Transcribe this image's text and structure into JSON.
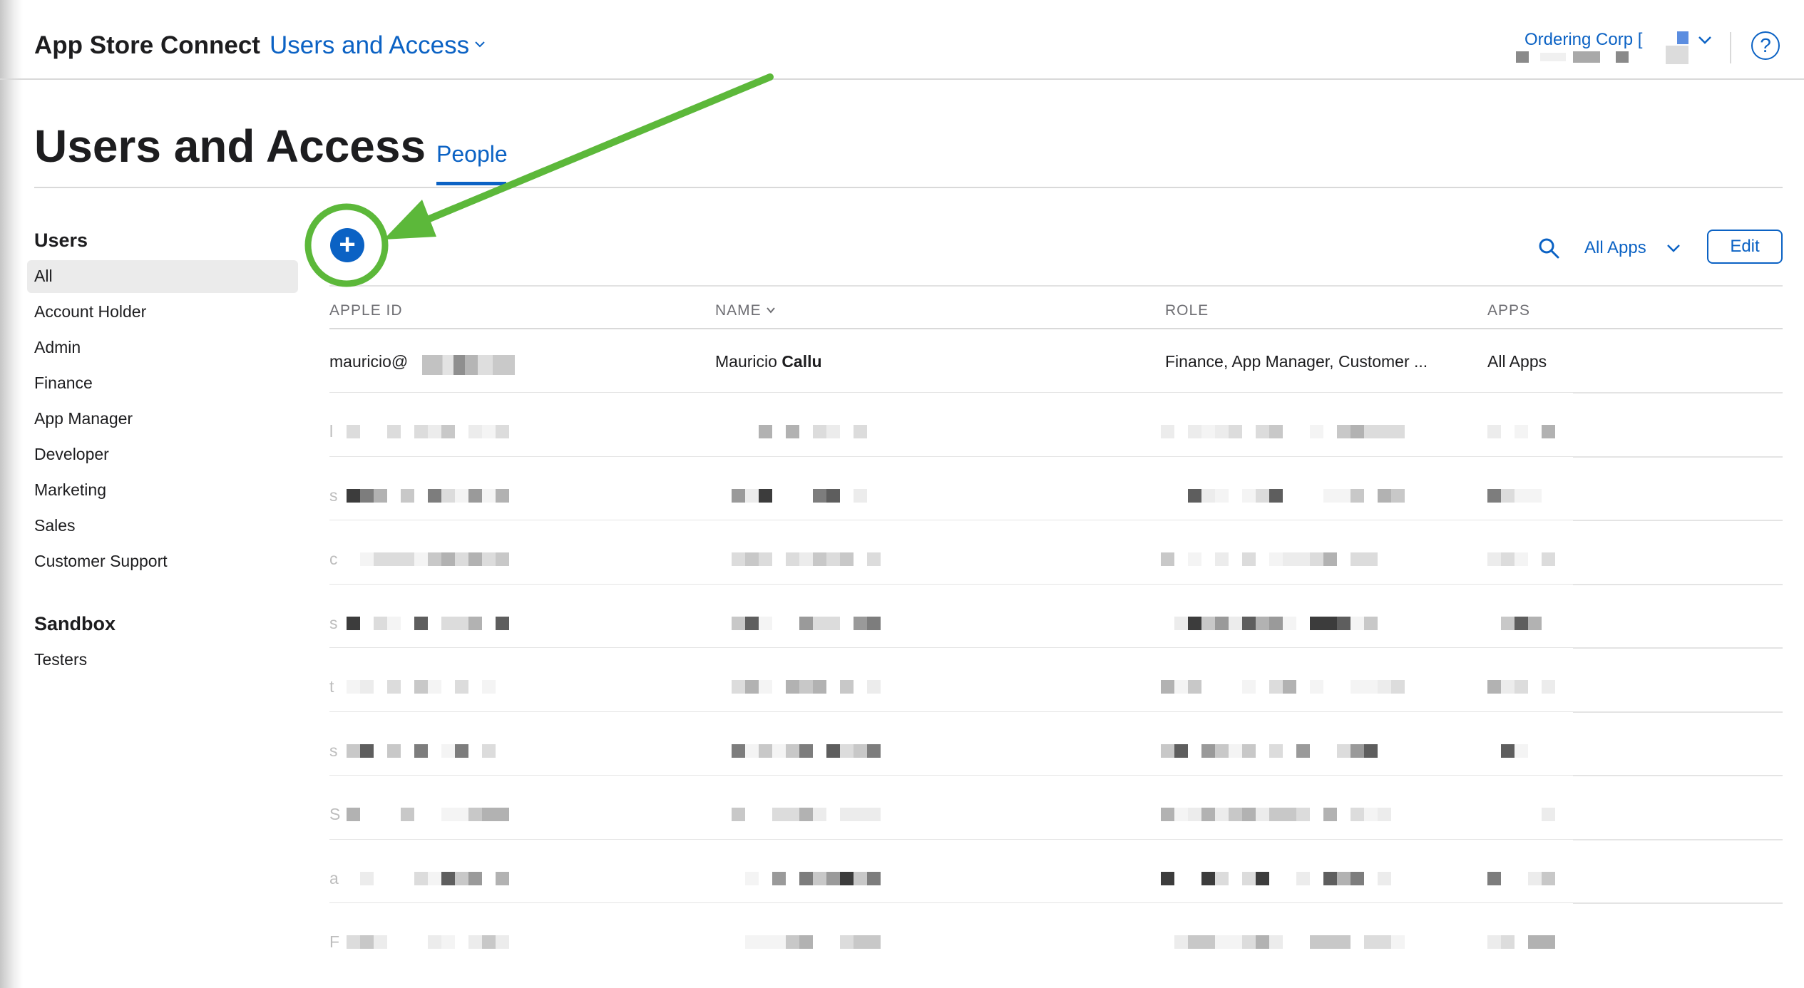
{
  "header": {
    "brand": "App Store Connect",
    "section_link": "Users and Access",
    "account_name": "Ordering Corp [",
    "help_label": "?"
  },
  "page": {
    "title": "Users and Access",
    "tabs": [
      {
        "label": "People",
        "active": true
      }
    ]
  },
  "sidebar": {
    "users_heading": "Users",
    "user_items": [
      {
        "label": "All",
        "selected": true
      },
      {
        "label": "Account Holder"
      },
      {
        "label": "Admin"
      },
      {
        "label": "Finance"
      },
      {
        "label": "App Manager"
      },
      {
        "label": "Developer"
      },
      {
        "label": "Marketing"
      },
      {
        "label": "Sales"
      },
      {
        "label": "Customer Support"
      }
    ],
    "sandbox_heading": "Sandbox",
    "sandbox_items": [
      {
        "label": "Testers"
      }
    ]
  },
  "toolbar": {
    "add_label": "+",
    "filter_label": "All Apps",
    "edit_label": "Edit"
  },
  "table": {
    "columns": [
      "APPLE ID",
      "NAME",
      "ROLE",
      "APPS"
    ],
    "sorted_column": "NAME",
    "rows": [
      {
        "apple_id": "mauricio@",
        "name_first": "Mauricio",
        "name_last": "Callu",
        "role": "Finance, App Manager, Customer ...",
        "apps": "All Apps"
      }
    ],
    "redacted_row_initials": [
      "l",
      "s",
      "c",
      "s",
      "t",
      "s",
      "S",
      "a",
      "F"
    ]
  },
  "colors": {
    "accent": "#0b62c4",
    "annotation": "#5cb83a"
  },
  "icons": [
    "chevron-down-icon",
    "help-icon",
    "plus-icon",
    "search-icon",
    "arrow-annotation",
    "circle-annotation"
  ]
}
